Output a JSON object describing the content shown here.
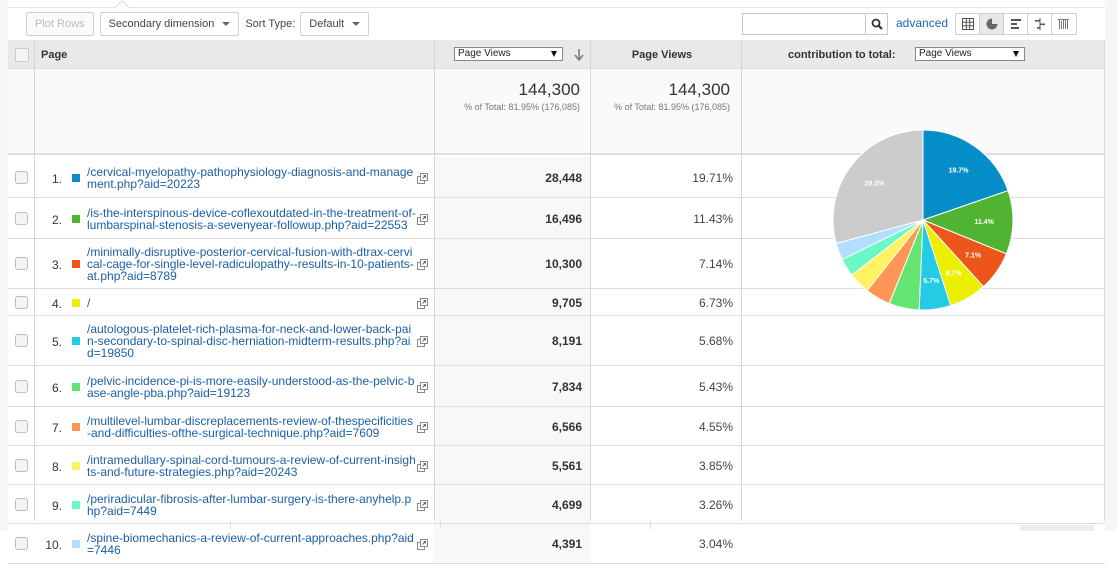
{
  "toolbar": {
    "plot_rows": "Plot Rows",
    "secondary_dimension": "Secondary dimension",
    "sort_type_label": "Sort Type:",
    "sort_type_value": "Default",
    "search_value": "",
    "search_placeholder": "",
    "advanced": "advanced",
    "view_buttons": [
      {
        "name": "data-table-icon",
        "active": false
      },
      {
        "name": "percentage-pie-icon",
        "active": true
      },
      {
        "name": "performance-bars-icon",
        "active": false
      },
      {
        "name": "comparison-icon",
        "active": false
      },
      {
        "name": "term-cloud-icon",
        "active": false
      }
    ]
  },
  "table": {
    "headers": {
      "page": "Page",
      "metric_select": "Page Views",
      "metric2": "Page Views",
      "contribution_label": "contribution to total:",
      "contribution_select": "Page Views"
    },
    "summary": {
      "total1": "144,300",
      "sub1": "% of Total: 81.95% (176,085)",
      "total2": "144,300",
      "sub2": "% of Total: 81.95% (176,085)"
    },
    "rows": [
      {
        "num": "1.",
        "color": "#058dc7",
        "page": "/cervical-myelopathy-pathophysiology-diagnosis-and-management.php?aid=20223",
        "views": "28,448",
        "pct": "19.71%"
      },
      {
        "num": "2.",
        "color": "#50b432",
        "page": "/is-the-interspinous-device-coflexoutdated-in-the-treatment-of-lumbarspinal-stenosis-a-sevenyear-followup.php?aid=22553",
        "views": "16,496",
        "pct": "11.43%"
      },
      {
        "num": "3.",
        "color": "#ed561b",
        "page": "/minimally-disruptive-posterior-cervical-fusion-with-dtrax-cervical-cage-for-single-level-radiculopathy--results-in-10-patients-at.php?aid=8789",
        "views": "10,300",
        "pct": "7.14%"
      },
      {
        "num": "4.",
        "color": "#edef00",
        "page": "/",
        "views": "9,705",
        "pct": "6.73%"
      },
      {
        "num": "5.",
        "color": "#24cbe5",
        "page": "/autologous-platelet-rich-plasma-for-neck-and-lower-back-pain-secondary-to-spinal-disc-herniation-midterm-results.php?aid=19850",
        "views": "8,191",
        "pct": "5.68%"
      },
      {
        "num": "6.",
        "color": "#64e572",
        "page": "/pelvic-incidence-pi-is-more-easily-understood-as-the-pelvic-base-angle-pba.php?aid=19123",
        "views": "7,834",
        "pct": "5.43%"
      },
      {
        "num": "7.",
        "color": "#ff9655",
        "page": "/multilevel-lumbar-discreplacements-review-of-thespecificities-and-difficulties-ofthe-surgical-technique.php?aid=7609",
        "views": "6,566",
        "pct": "4.55%"
      },
      {
        "num": "8.",
        "color": "#fff263",
        "page": "/intramedullary-spinal-cord-tumours-a-review-of-current-insights-and-future-strategies.php?aid=20243",
        "views": "5,561",
        "pct": "3.85%"
      },
      {
        "num": "9.",
        "color": "#6af9c4",
        "page": "/periradicular-fibrosis-after-lumbar-surgery-is-there-anyhelp.php?aid=7449",
        "views": "4,699",
        "pct": "3.26%"
      },
      {
        "num": "10.",
        "color": "#b2deff",
        "page": "/spine-biomechanics-a-review-of-current-approaches.php?aid=7446",
        "views": "4,391",
        "pct": "3.04%"
      }
    ]
  },
  "chart_data": {
    "type": "pie",
    "title": "contribution to total: Page Views",
    "slices": [
      {
        "label": "/cervical-myelopathy-pathophysiology-diagnosis-and-management.php?aid=20223",
        "value": 19.71,
        "color": "#058dc7",
        "data_label": "19.7%"
      },
      {
        "label": "/is-the-interspinous-device-coflexoutdated-in-the-treatment-of-lumbarspinal-stenosis-a-sevenyear-followup.php?aid=22553",
        "value": 11.43,
        "color": "#50b432",
        "data_label": "11.4%"
      },
      {
        "label": "/minimally-disruptive-posterior-cervical-fusion-with-dtrax-cervical-cage-for-single-level-radiculopathy--results-in-10-patients-at.php?aid=8789",
        "value": 7.14,
        "color": "#ed561b",
        "data_label": "7.1%"
      },
      {
        "label": "/",
        "value": 6.73,
        "color": "#edef00",
        "data_label": "6.7%"
      },
      {
        "label": "/autologous-platelet-rich-plasma-for-neck-and-lower-back-pain-secondary-to-spinal-disc-herniation-midterm-results.php?aid=19850",
        "value": 5.68,
        "color": "#24cbe5",
        "data_label": "5.7%"
      },
      {
        "label": "/pelvic-incidence-pi-is-more-easily-understood-as-the-pelvic-base-angle-pba.php?aid=19123",
        "value": 5.43,
        "color": "#64e572",
        "data_label": ""
      },
      {
        "label": "/multilevel-lumbar-discreplacements-review-of-thespecificities-and-difficulties-ofthe-surgical-technique.php?aid=7609",
        "value": 4.55,
        "color": "#ff9655",
        "data_label": ""
      },
      {
        "label": "/intramedullary-spinal-cord-tumours-a-review-of-current-insights-and-future-strategies.php?aid=20243",
        "value": 3.85,
        "color": "#fff263",
        "data_label": ""
      },
      {
        "label": "/periradicular-fibrosis-after-lumbar-surgery-is-there-anyhelp.php?aid=7449",
        "value": 3.26,
        "color": "#6af9c4",
        "data_label": ""
      },
      {
        "label": "/spine-biomechanics-a-review-of-current-approaches.php?aid=7446",
        "value": 3.04,
        "color": "#b2deff",
        "data_label": ""
      },
      {
        "label": "(other)",
        "value": 29.18,
        "color": "#cccccc",
        "data_label": "29.2%"
      }
    ]
  }
}
